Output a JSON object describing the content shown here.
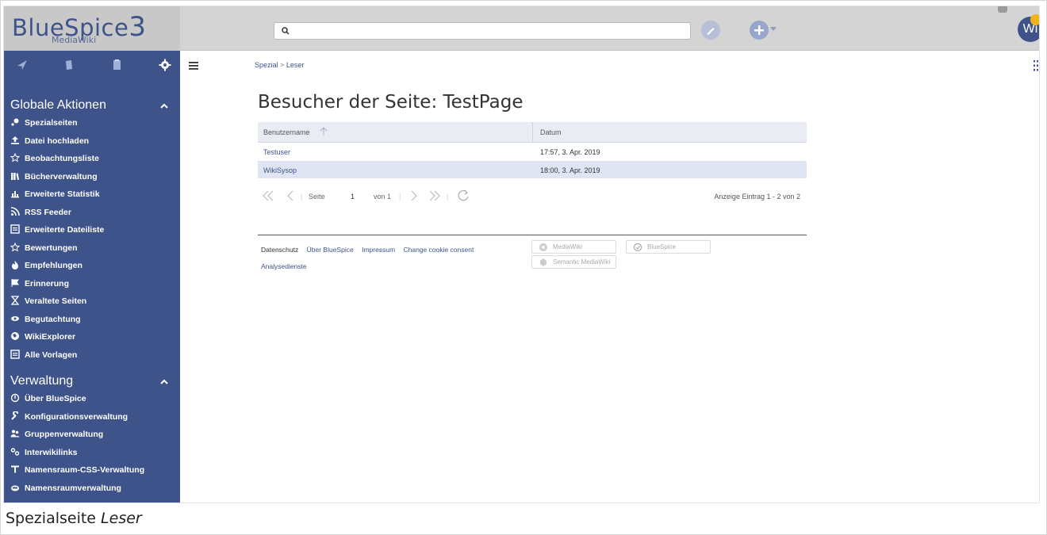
{
  "topbar": {
    "logo_main": "BlueSpice",
    "logo_version": "3",
    "logo_sub": "MediaWiki",
    "avatar_text": "Wi"
  },
  "sidebar": {
    "groups": [
      {
        "title": "Globale Aktionen",
        "items": [
          {
            "label": "Spezialseiten",
            "icon": "special-pages-icon"
          },
          {
            "label": "Datei hochladen",
            "icon": "upload-icon"
          },
          {
            "label": "Beobachtungsliste",
            "icon": "star-icon"
          },
          {
            "label": "Bücherverwaltung",
            "icon": "books-icon"
          },
          {
            "label": "Erweiterte Statistik",
            "icon": "chart-icon"
          },
          {
            "label": "RSS Feeder",
            "icon": "rss-icon"
          },
          {
            "label": "Erweiterte Dateiliste",
            "icon": "file-list-icon"
          },
          {
            "label": "Bewertungen",
            "icon": "star-icon"
          },
          {
            "label": "Empfehlungen",
            "icon": "recommend-icon"
          },
          {
            "label": "Erinnerung",
            "icon": "flag-icon"
          },
          {
            "label": "Veraltete Seiten",
            "icon": "hourglass-icon"
          },
          {
            "label": "Begutachtung",
            "icon": "eye-icon"
          },
          {
            "label": "WikiExplorer",
            "icon": "globe-icon"
          },
          {
            "label": "Alle Vorlagen",
            "icon": "template-icon"
          }
        ]
      },
      {
        "title": "Verwaltung",
        "items": [
          {
            "label": "Über BlueSpice",
            "icon": "info-icon"
          },
          {
            "label": "Konfigurationsverwaltung",
            "icon": "wrench-icon"
          },
          {
            "label": "Gruppenverwaltung",
            "icon": "group-icon"
          },
          {
            "label": "Interwikilinks",
            "icon": "link-icon"
          },
          {
            "label": "Namensraum-CSS-Verwaltung",
            "icon": "css-icon"
          },
          {
            "label": "Namensraumverwaltung",
            "icon": "namespace-icon"
          }
        ]
      }
    ]
  },
  "breadcrumb": {
    "root": "Spezial",
    "separator": ">",
    "current": "Leser"
  },
  "page": {
    "title": "Besucher der Seite: TestPage"
  },
  "grid": {
    "columns": [
      "Benutzername",
      "Datum"
    ],
    "rows": [
      {
        "user": "Testuser",
        "date": "17:57, 3. Apr. 2019"
      },
      {
        "user": "WikiSysop",
        "date": "18:00, 3. Apr. 2019"
      }
    ]
  },
  "pager": {
    "page_label": "Seite",
    "page_value": "1",
    "of_label": "von 1",
    "info": "Anzeige Eintrag 1 - 2 von 2"
  },
  "footer": {
    "links": [
      "Datenschutz",
      "Über BlueSpice",
      "Impressum",
      "Change cookie consent"
    ],
    "links2": [
      "Analysedienste"
    ],
    "badges": [
      "MediaWiki",
      "BlueSpice",
      "Semantic MediaWiki"
    ]
  },
  "caption": {
    "prefix": "Spezialseite",
    "name": "Leser"
  }
}
